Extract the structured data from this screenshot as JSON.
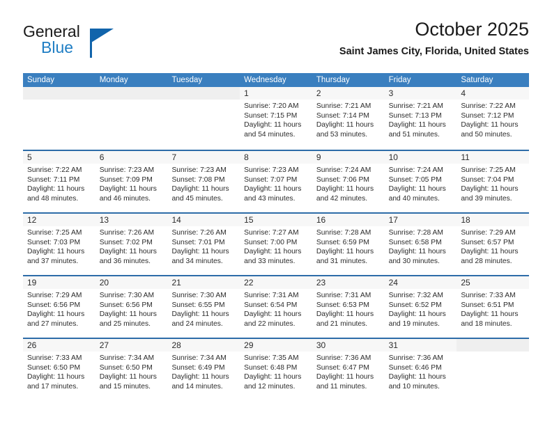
{
  "brand": {
    "line1": "General",
    "line2": "Blue",
    "accent_color": "#1164ab",
    "blue_text_color": "#1f7ec4"
  },
  "header": {
    "title": "October 2025",
    "location": "Saint James City, Florida, United States",
    "header_bg": "#3a7fbf",
    "row_divider": "#2d6ca8"
  },
  "weekdays": [
    "Sunday",
    "Monday",
    "Tuesday",
    "Wednesday",
    "Thursday",
    "Friday",
    "Saturday"
  ],
  "weeks": [
    [
      {
        "date": "",
        "empty": true,
        "sunrise": "",
        "sunset": "",
        "daylight_1": "",
        "daylight_2": ""
      },
      {
        "date": "",
        "empty": true,
        "sunrise": "",
        "sunset": "",
        "daylight_1": "",
        "daylight_2": ""
      },
      {
        "date": "",
        "empty": true,
        "sunrise": "",
        "sunset": "",
        "daylight_1": "",
        "daylight_2": ""
      },
      {
        "date": "1",
        "empty": false,
        "sunrise": "Sunrise: 7:20 AM",
        "sunset": "Sunset: 7:15 PM",
        "daylight_1": "Daylight: 11 hours",
        "daylight_2": "and 54 minutes."
      },
      {
        "date": "2",
        "empty": false,
        "sunrise": "Sunrise: 7:21 AM",
        "sunset": "Sunset: 7:14 PM",
        "daylight_1": "Daylight: 11 hours",
        "daylight_2": "and 53 minutes."
      },
      {
        "date": "3",
        "empty": false,
        "sunrise": "Sunrise: 7:21 AM",
        "sunset": "Sunset: 7:13 PM",
        "daylight_1": "Daylight: 11 hours",
        "daylight_2": "and 51 minutes."
      },
      {
        "date": "4",
        "empty": false,
        "sunrise": "Sunrise: 7:22 AM",
        "sunset": "Sunset: 7:12 PM",
        "daylight_1": "Daylight: 11 hours",
        "daylight_2": "and 50 minutes."
      }
    ],
    [
      {
        "date": "5",
        "empty": false,
        "sunrise": "Sunrise: 7:22 AM",
        "sunset": "Sunset: 7:11 PM",
        "daylight_1": "Daylight: 11 hours",
        "daylight_2": "and 48 minutes."
      },
      {
        "date": "6",
        "empty": false,
        "sunrise": "Sunrise: 7:23 AM",
        "sunset": "Sunset: 7:09 PM",
        "daylight_1": "Daylight: 11 hours",
        "daylight_2": "and 46 minutes."
      },
      {
        "date": "7",
        "empty": false,
        "sunrise": "Sunrise: 7:23 AM",
        "sunset": "Sunset: 7:08 PM",
        "daylight_1": "Daylight: 11 hours",
        "daylight_2": "and 45 minutes."
      },
      {
        "date": "8",
        "empty": false,
        "sunrise": "Sunrise: 7:23 AM",
        "sunset": "Sunset: 7:07 PM",
        "daylight_1": "Daylight: 11 hours",
        "daylight_2": "and 43 minutes."
      },
      {
        "date": "9",
        "empty": false,
        "sunrise": "Sunrise: 7:24 AM",
        "sunset": "Sunset: 7:06 PM",
        "daylight_1": "Daylight: 11 hours",
        "daylight_2": "and 42 minutes."
      },
      {
        "date": "10",
        "empty": false,
        "sunrise": "Sunrise: 7:24 AM",
        "sunset": "Sunset: 7:05 PM",
        "daylight_1": "Daylight: 11 hours",
        "daylight_2": "and 40 minutes."
      },
      {
        "date": "11",
        "empty": false,
        "sunrise": "Sunrise: 7:25 AM",
        "sunset": "Sunset: 7:04 PM",
        "daylight_1": "Daylight: 11 hours",
        "daylight_2": "and 39 minutes."
      }
    ],
    [
      {
        "date": "12",
        "empty": false,
        "sunrise": "Sunrise: 7:25 AM",
        "sunset": "Sunset: 7:03 PM",
        "daylight_1": "Daylight: 11 hours",
        "daylight_2": "and 37 minutes."
      },
      {
        "date": "13",
        "empty": false,
        "sunrise": "Sunrise: 7:26 AM",
        "sunset": "Sunset: 7:02 PM",
        "daylight_1": "Daylight: 11 hours",
        "daylight_2": "and 36 minutes."
      },
      {
        "date": "14",
        "empty": false,
        "sunrise": "Sunrise: 7:26 AM",
        "sunset": "Sunset: 7:01 PM",
        "daylight_1": "Daylight: 11 hours",
        "daylight_2": "and 34 minutes."
      },
      {
        "date": "15",
        "empty": false,
        "sunrise": "Sunrise: 7:27 AM",
        "sunset": "Sunset: 7:00 PM",
        "daylight_1": "Daylight: 11 hours",
        "daylight_2": "and 33 minutes."
      },
      {
        "date": "16",
        "empty": false,
        "sunrise": "Sunrise: 7:28 AM",
        "sunset": "Sunset: 6:59 PM",
        "daylight_1": "Daylight: 11 hours",
        "daylight_2": "and 31 minutes."
      },
      {
        "date": "17",
        "empty": false,
        "sunrise": "Sunrise: 7:28 AM",
        "sunset": "Sunset: 6:58 PM",
        "daylight_1": "Daylight: 11 hours",
        "daylight_2": "and 30 minutes."
      },
      {
        "date": "18",
        "empty": false,
        "sunrise": "Sunrise: 7:29 AM",
        "sunset": "Sunset: 6:57 PM",
        "daylight_1": "Daylight: 11 hours",
        "daylight_2": "and 28 minutes."
      }
    ],
    [
      {
        "date": "19",
        "empty": false,
        "sunrise": "Sunrise: 7:29 AM",
        "sunset": "Sunset: 6:56 PM",
        "daylight_1": "Daylight: 11 hours",
        "daylight_2": "and 27 minutes."
      },
      {
        "date": "20",
        "empty": false,
        "sunrise": "Sunrise: 7:30 AM",
        "sunset": "Sunset: 6:56 PM",
        "daylight_1": "Daylight: 11 hours",
        "daylight_2": "and 25 minutes."
      },
      {
        "date": "21",
        "empty": false,
        "sunrise": "Sunrise: 7:30 AM",
        "sunset": "Sunset: 6:55 PM",
        "daylight_1": "Daylight: 11 hours",
        "daylight_2": "and 24 minutes."
      },
      {
        "date": "22",
        "empty": false,
        "sunrise": "Sunrise: 7:31 AM",
        "sunset": "Sunset: 6:54 PM",
        "daylight_1": "Daylight: 11 hours",
        "daylight_2": "and 22 minutes."
      },
      {
        "date": "23",
        "empty": false,
        "sunrise": "Sunrise: 7:31 AM",
        "sunset": "Sunset: 6:53 PM",
        "daylight_1": "Daylight: 11 hours",
        "daylight_2": "and 21 minutes."
      },
      {
        "date": "24",
        "empty": false,
        "sunrise": "Sunrise: 7:32 AM",
        "sunset": "Sunset: 6:52 PM",
        "daylight_1": "Daylight: 11 hours",
        "daylight_2": "and 19 minutes."
      },
      {
        "date": "25",
        "empty": false,
        "sunrise": "Sunrise: 7:33 AM",
        "sunset": "Sunset: 6:51 PM",
        "daylight_1": "Daylight: 11 hours",
        "daylight_2": "and 18 minutes."
      }
    ],
    [
      {
        "date": "26",
        "empty": false,
        "sunrise": "Sunrise: 7:33 AM",
        "sunset": "Sunset: 6:50 PM",
        "daylight_1": "Daylight: 11 hours",
        "daylight_2": "and 17 minutes."
      },
      {
        "date": "27",
        "empty": false,
        "sunrise": "Sunrise: 7:34 AM",
        "sunset": "Sunset: 6:50 PM",
        "daylight_1": "Daylight: 11 hours",
        "daylight_2": "and 15 minutes."
      },
      {
        "date": "28",
        "empty": false,
        "sunrise": "Sunrise: 7:34 AM",
        "sunset": "Sunset: 6:49 PM",
        "daylight_1": "Daylight: 11 hours",
        "daylight_2": "and 14 minutes."
      },
      {
        "date": "29",
        "empty": false,
        "sunrise": "Sunrise: 7:35 AM",
        "sunset": "Sunset: 6:48 PM",
        "daylight_1": "Daylight: 11 hours",
        "daylight_2": "and 12 minutes."
      },
      {
        "date": "30",
        "empty": false,
        "sunrise": "Sunrise: 7:36 AM",
        "sunset": "Sunset: 6:47 PM",
        "daylight_1": "Daylight: 11 hours",
        "daylight_2": "and 11 minutes."
      },
      {
        "date": "31",
        "empty": false,
        "sunrise": "Sunrise: 7:36 AM",
        "sunset": "Sunset: 6:46 PM",
        "daylight_1": "Daylight: 11 hours",
        "daylight_2": "and 10 minutes."
      },
      {
        "date": "",
        "empty": true,
        "sunrise": "",
        "sunset": "",
        "daylight_1": "",
        "daylight_2": ""
      }
    ]
  ]
}
